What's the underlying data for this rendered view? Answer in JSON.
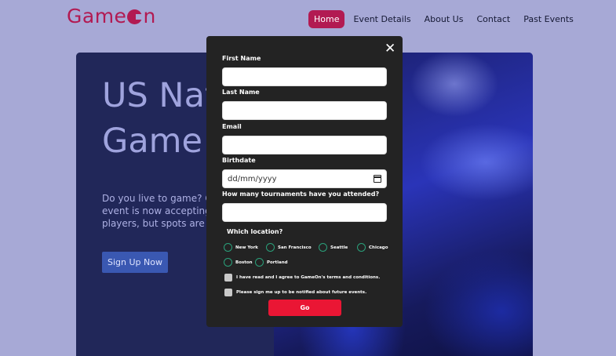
{
  "logo": {
    "text_before": "Game",
    "text_after": "n"
  },
  "nav": {
    "items": [
      {
        "label": "Home",
        "active": true
      },
      {
        "label": "Event Details",
        "active": false
      },
      {
        "label": "About Us",
        "active": false
      },
      {
        "label": "Contact",
        "active": false
      },
      {
        "label": "Past Events",
        "active": false
      }
    ]
  },
  "hero": {
    "title": "US Nat\nGame",
    "text": "Do you live to game? Our\nevent is now accepting re\nplayers, but spots are lim",
    "cta_label": "Sign Up Now"
  },
  "modal": {
    "close_glyph": "✕",
    "first_name": {
      "label": "First Name",
      "value": ""
    },
    "last_name": {
      "label": "Last Name",
      "value": ""
    },
    "email": {
      "label": "Email",
      "value": ""
    },
    "birthdate": {
      "label": "Birthdate",
      "placeholder": "dd/mm/yyyy"
    },
    "tournaments": {
      "label": "How many tournaments have you attended?",
      "value": ""
    },
    "location_label": "Which location?",
    "locations": [
      "New York",
      "San Francisco",
      "Seattle",
      "Chicago",
      "Boston",
      "Portland"
    ],
    "terms_label": "I have read and I agree to GameOn's terms and conditions.",
    "notify_label": "Please sign me up to be notified about future events.",
    "submit_label": "Go"
  },
  "colors": {
    "brand": "#b21a52",
    "background": "#a7a9d6",
    "submit": "#ea1634",
    "radio": "#2aa07a"
  }
}
